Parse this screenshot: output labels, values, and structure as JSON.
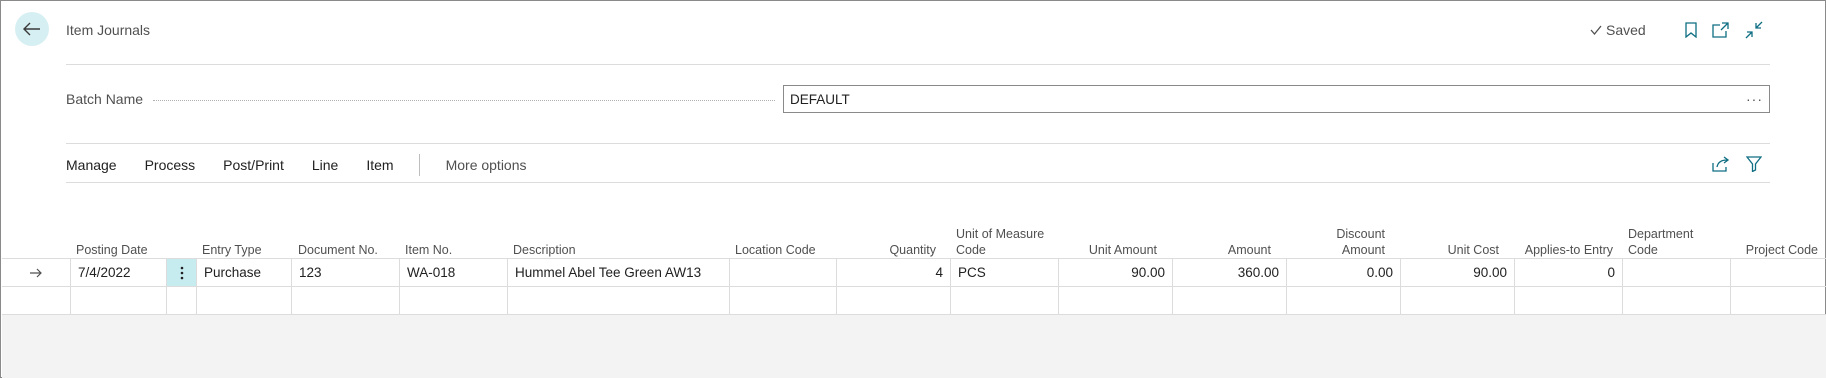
{
  "header": {
    "title": "Item Journals",
    "saved_label": "Saved"
  },
  "icons": {
    "back": "arrow-left-icon",
    "saved_check": "checkmark-icon",
    "bookmark": "bookmark-icon",
    "open_new": "open-new-window-icon",
    "collapse": "collapse-icon",
    "share": "share-icon",
    "filter": "filter-icon",
    "row_arrow": "arrow-right-icon",
    "row_menu": "vertical-ellipsis-icon"
  },
  "batch": {
    "label": "Batch Name",
    "value": "DEFAULT",
    "lookup": "···"
  },
  "actions": {
    "items": [
      "Manage",
      "Process",
      "Post/Print",
      "Line",
      "Item"
    ],
    "more": "More options"
  },
  "columns": {
    "posting_date": "Posting Date",
    "entry_type": "Entry Type",
    "document_no": "Document No.",
    "item_no": "Item No.",
    "description": "Description",
    "location_code": "Location Code",
    "quantity": "Quantity",
    "uom_line1": "Unit of Measure",
    "uom_line2": "Code",
    "unit_amount": "Unit Amount",
    "amount": "Amount",
    "discount_line1": "Discount",
    "discount_line2": "Amount",
    "unit_cost": "Unit Cost",
    "applies_to_entry": "Applies-to Entry",
    "department_line1": "Department",
    "department_line2": "Code",
    "project_code": "Project Code"
  },
  "rows": [
    {
      "posting_date": "7/4/2022",
      "entry_type": "Purchase",
      "document_no": "123",
      "item_no": "WA-018",
      "description": "Hummel Abel Tee Green AW13",
      "location_code": "",
      "quantity": "4",
      "uom": "PCS",
      "unit_amount": "90.00",
      "amount": "360.00",
      "discount_amount": "0.00",
      "unit_cost": "90.00",
      "applies_to_entry": "0",
      "department_code": "",
      "project_code": ""
    }
  ]
}
